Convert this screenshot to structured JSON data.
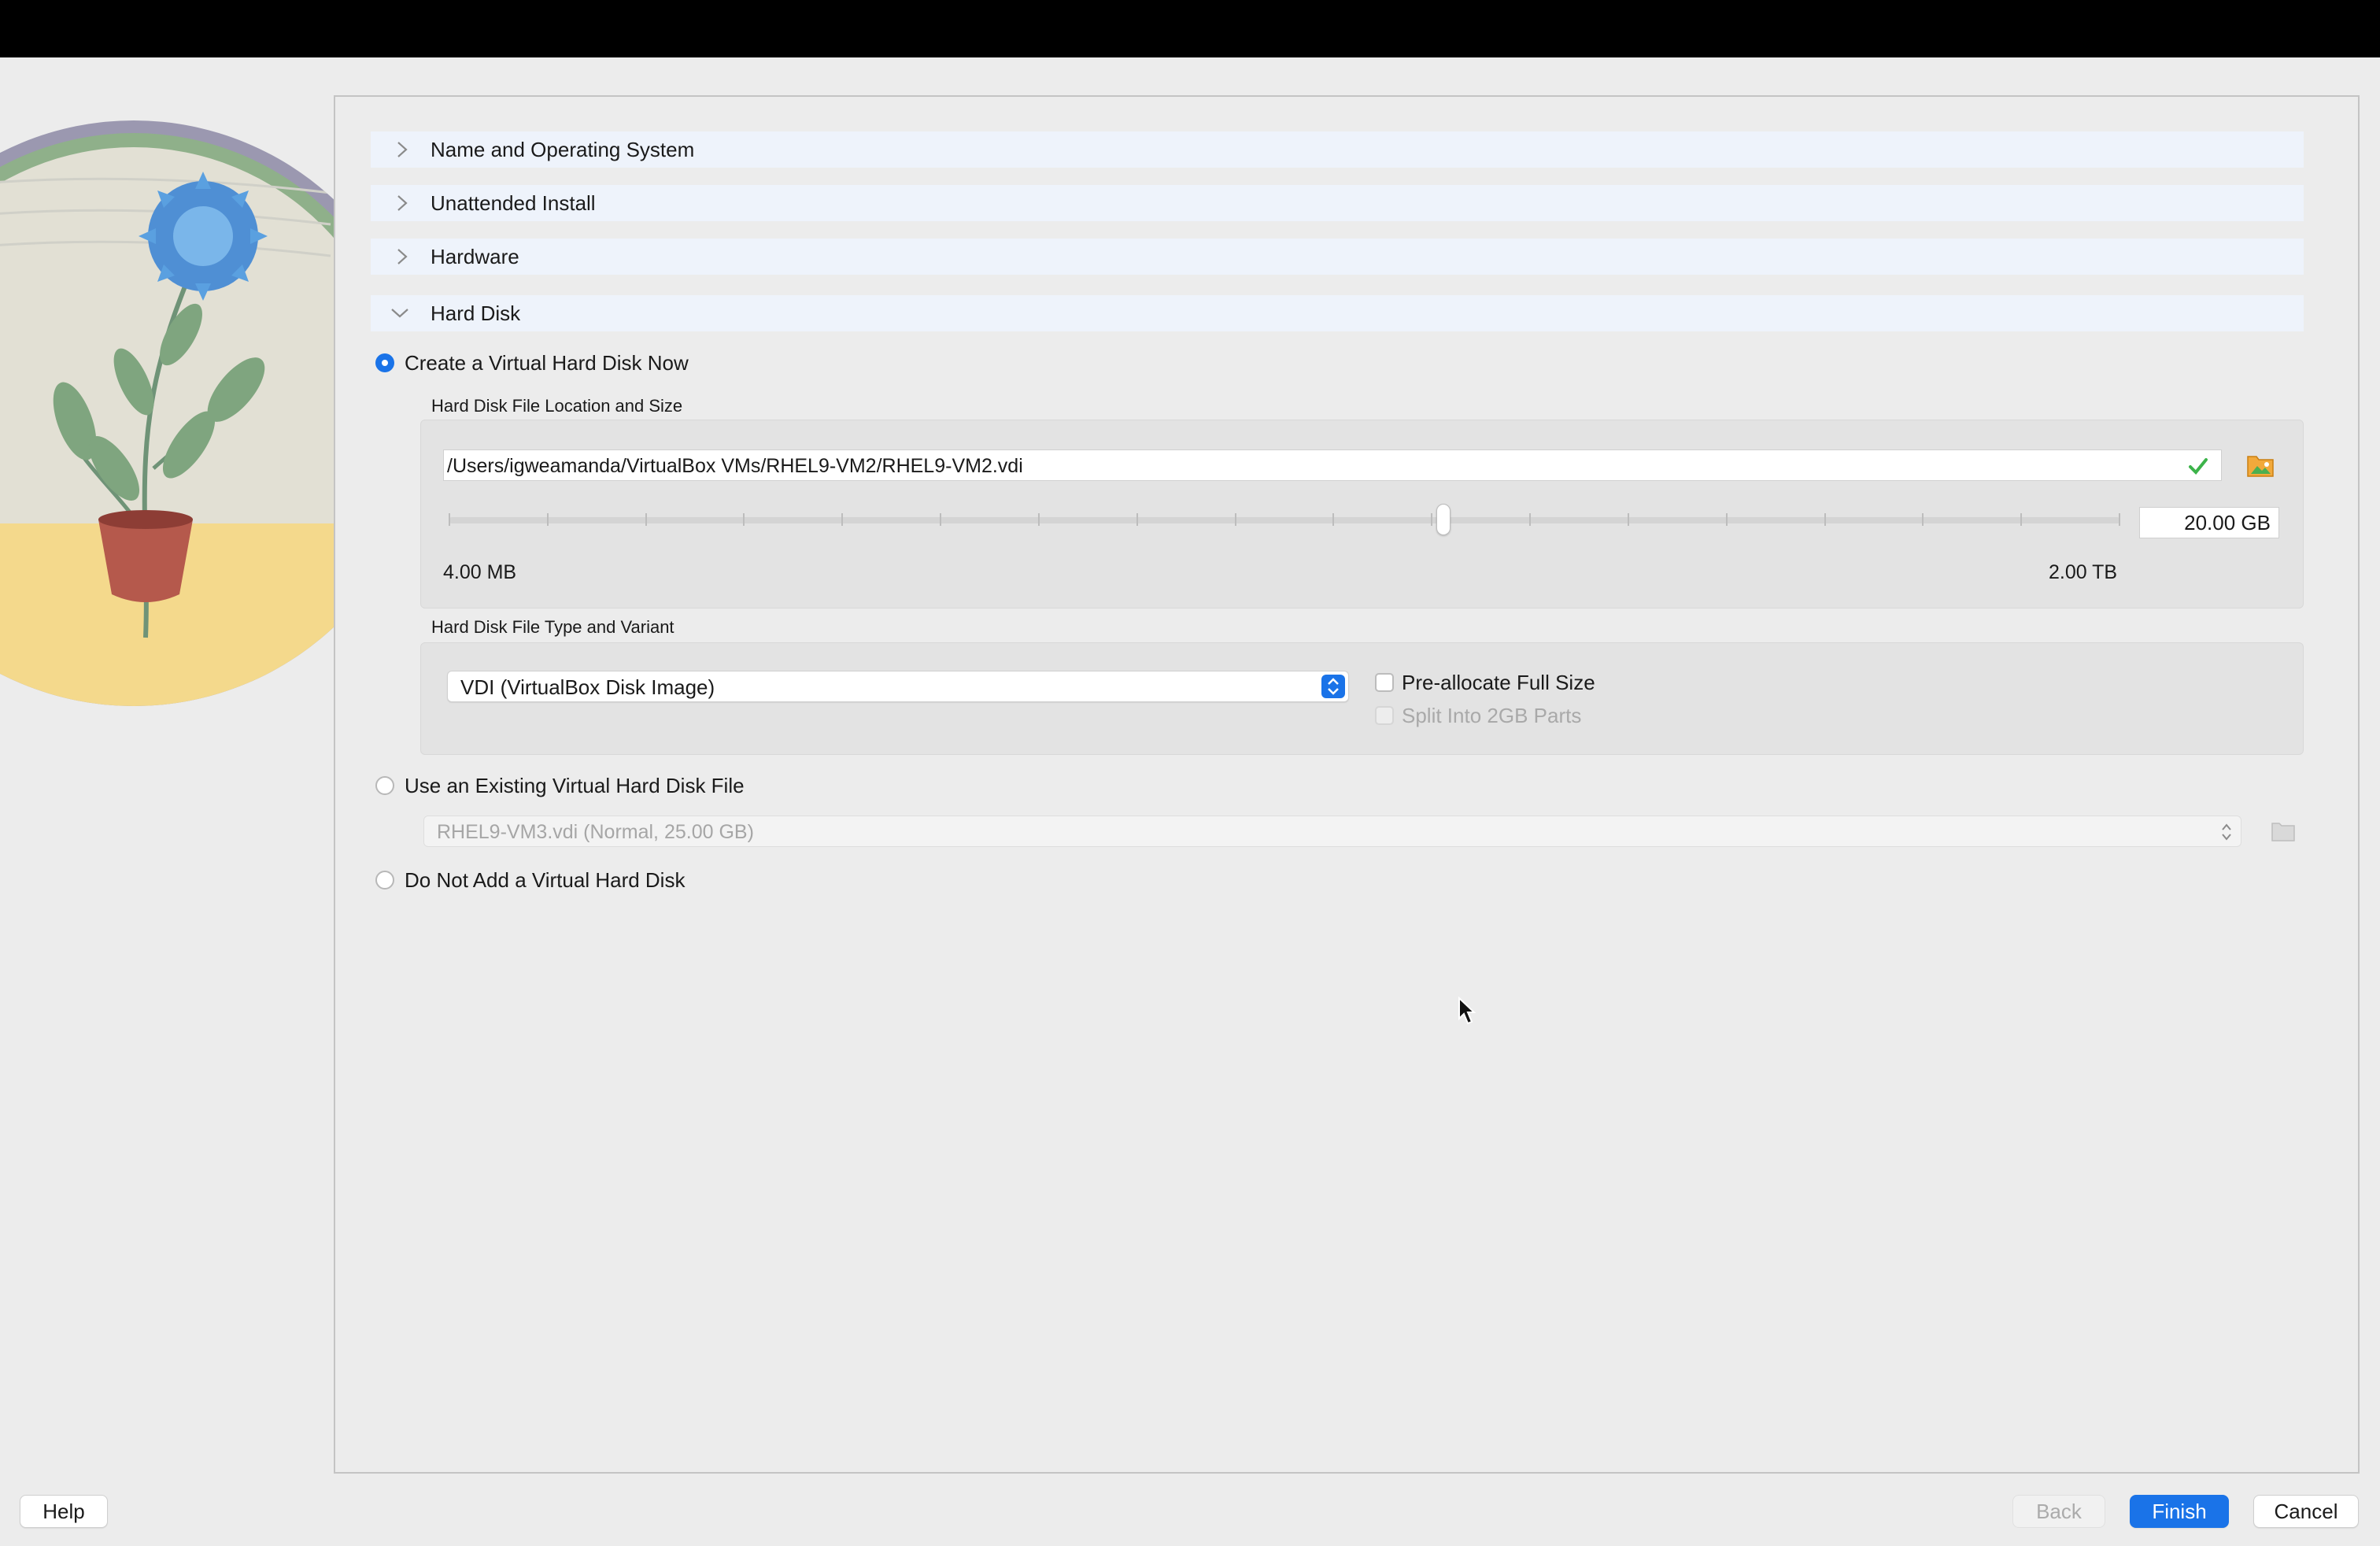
{
  "sections": [
    {
      "label": "Name and Operating System",
      "expanded": false
    },
    {
      "label": "Unattended Install",
      "expanded": false
    },
    {
      "label": "Hardware",
      "expanded": false
    },
    {
      "label": "Hard Disk",
      "expanded": true
    }
  ],
  "hard_disk": {
    "options": {
      "create": {
        "label": "Create a Virtual Hard Disk Now",
        "selected": true
      },
      "existing": {
        "label": "Use an Existing Virtual Hard Disk File",
        "selected": false
      },
      "none": {
        "label": "Do Not Add a Virtual Hard Disk",
        "selected": false
      }
    },
    "location_group_title": "Hard Disk File Location and Size",
    "file_path": "/Users/igweamanda/VirtualBox VMs/RHEL9-VM2/RHEL9-VM2.vdi",
    "size_value": "20.00 GB",
    "size_slider_fraction": 0.595,
    "size_min_label": "4.00 MB",
    "size_max_label": "2.00 TB",
    "type_group_title": "Hard Disk File Type and Variant",
    "disk_type_selected": "VDI (VirtualBox Disk Image)",
    "preallocate_label": "Pre-allocate Full Size",
    "preallocate_checked": false,
    "split_label": "Split Into 2GB Parts",
    "split_enabled": false,
    "existing_disk_value": "RHEL9-VM3.vdi (Normal, 25.00 GB)"
  },
  "buttons": {
    "help": "Help",
    "back": "Back",
    "finish": "Finish",
    "cancel": "Cancel"
  },
  "colors": {
    "accent": "#1a73e8",
    "section_header_bg": "#eef3fb",
    "check_green": "#3cb34a"
  },
  "icons": {
    "section_collapsed": "chevron-right-icon",
    "section_expanded": "chevron-down-icon",
    "valid_path": "green-check-icon",
    "choose_file": "folder-icon"
  }
}
